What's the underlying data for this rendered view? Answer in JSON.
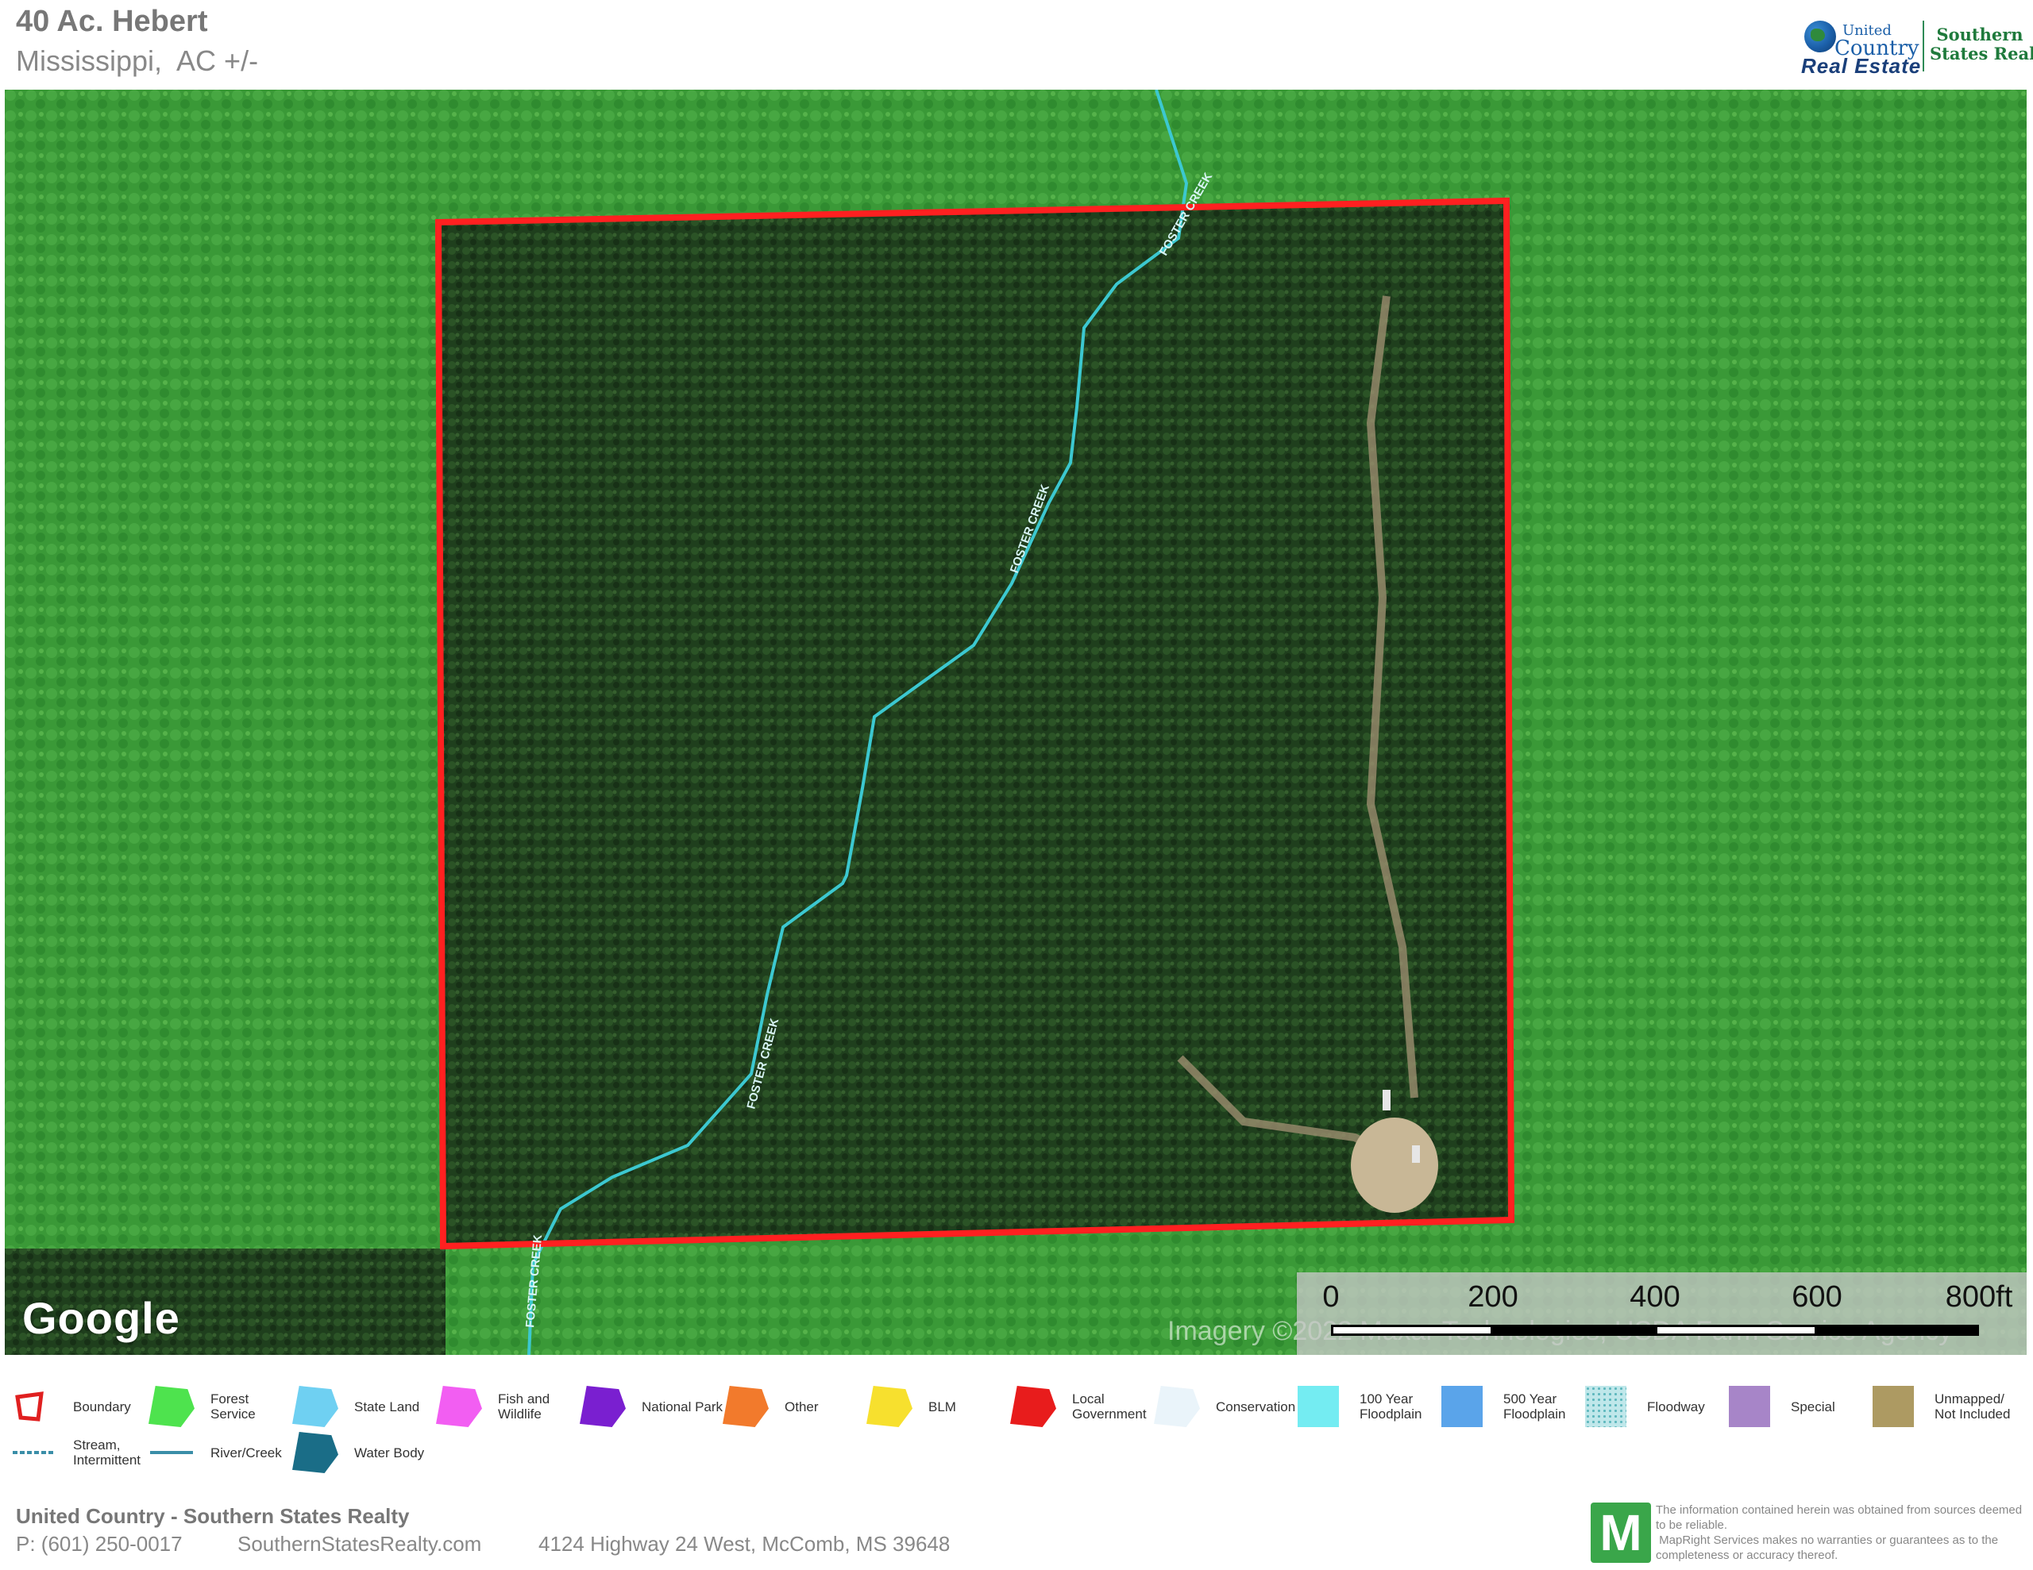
{
  "header": {
    "title": "40 Ac. Hebert",
    "subtitle": "Mississippi,  AC +/-"
  },
  "logos": {
    "united_country_line1": "United",
    "united_country_line2": "Country",
    "united_country_line3": "Real Estate",
    "southern_states": "Southern\nStates Realty"
  },
  "map": {
    "creek_labels": [
      "FOSTER CREEK",
      "FOSTER CREEK",
      "FOSTER CREEK",
      "FOSTER CREEK"
    ],
    "google_logo": "Google",
    "imagery_credit": "Imagery ©2022 Maxar Technologies, USDA Farm Service Agency",
    "scale_labels": [
      "0",
      "200",
      "400",
      "600",
      "800ft"
    ],
    "colors": {
      "boundary": "#ff2020",
      "creek": "#3cc8d0",
      "forest": "#379b36"
    }
  },
  "legend": [
    {
      "label": "Boundary",
      "color": "#e02020",
      "kind": "boundary"
    },
    {
      "label": "Forest\nService",
      "color": "#4ee34e",
      "kind": "shape"
    },
    {
      "label": "State Land",
      "color": "#6fd0f2",
      "kind": "shape"
    },
    {
      "label": "Fish and\nWildlife",
      "color": "#f25ef2",
      "kind": "shape"
    },
    {
      "label": "National Park",
      "color": "#7a1fd0",
      "kind": "shape"
    },
    {
      "label": "Other",
      "color": "#f27a2c",
      "kind": "shape"
    },
    {
      "label": "BLM",
      "color": "#f7e02e",
      "kind": "shape"
    },
    {
      "label": "Local\nGovernment",
      "color": "#e81c1c",
      "kind": "shape"
    },
    {
      "label": "Conservation",
      "color": "#eaf4fa",
      "kind": "shape"
    },
    {
      "label": "100 Year\nFloodplain",
      "color": "#74ecf2",
      "kind": "square"
    },
    {
      "label": "500 Year\nFloodplain",
      "color": "#5aa4ea",
      "kind": "square"
    },
    {
      "label": "Floodway",
      "color": "#bfe7ea",
      "kind": "dots"
    },
    {
      "label": "Special",
      "color": "#a785c8",
      "kind": "square"
    },
    {
      "label": "Unmapped/\nNot Included",
      "color": "#ad9a62",
      "kind": "square"
    },
    {
      "label": "Stream,\nIntermittent",
      "color": "#3a8ea8",
      "kind": "dash"
    },
    {
      "label": "River/Creek",
      "color": "#3a8ea8",
      "kind": "line"
    },
    {
      "label": "Water Body",
      "color": "#1a6d87",
      "kind": "shape"
    }
  ],
  "footer": {
    "company": "United Country - Southern States Realty",
    "phone": "P: (601) 250-0017",
    "website": "SouthernStatesRealty.com",
    "address": "4124 Highway 24 West, McComb, MS 39648",
    "mapright_logo": "M",
    "disclaimer": "The information contained herein was obtained from sources deemed to be reliable.\n MapRight Services makes no warranties or guarantees as to the completeness or accuracy thereof."
  }
}
